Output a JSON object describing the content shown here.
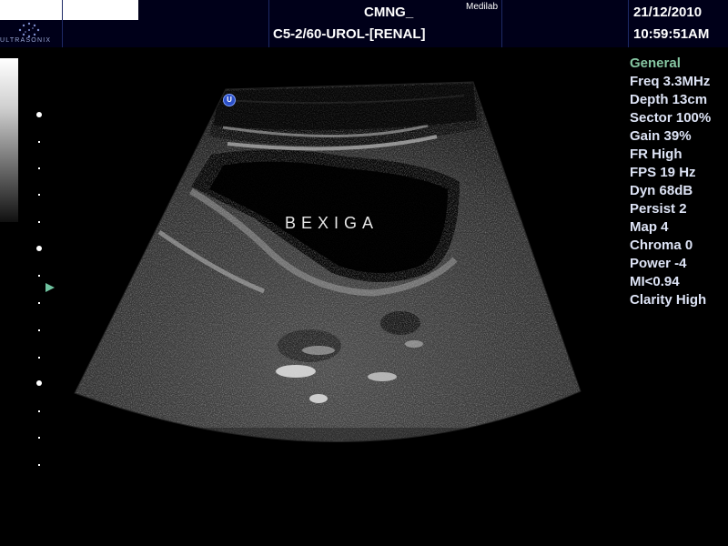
{
  "header": {
    "brand": "ULTRASONIX",
    "facility": "CMNG_",
    "clinic": "Medilab",
    "probe_preset": "C5-2/60-UROL-[RENAL]",
    "date": "21/12/2010",
    "time": "10:59:51AM"
  },
  "params": {
    "title": "General",
    "items": [
      "Freq 3.3MHz",
      "Depth 13cm",
      "Sector 100%",
      "Gain 39%",
      "FR High",
      "FPS 19 Hz",
      "Dyn 68dB",
      "Persist 2",
      "Map 4",
      "Chroma 0",
      "Power -4",
      "MI<0.94",
      "Clarity High"
    ]
  },
  "image": {
    "annotation": "BEXIGA",
    "orientation_marker": "U",
    "colors": {
      "header_bg": "#000019",
      "param_text": "#dde3f5",
      "param_title": "#86c6a2",
      "focus_marker": "#6fc3a0"
    }
  }
}
